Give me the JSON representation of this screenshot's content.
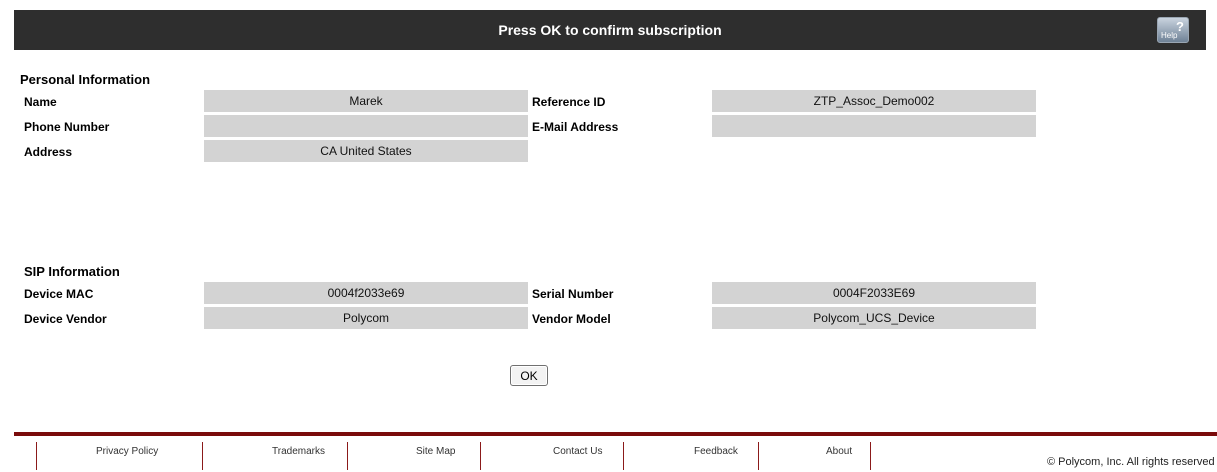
{
  "header": {
    "title": "Press OK to confirm subscription",
    "help_label": "Help",
    "help_icon": "help-icon"
  },
  "personal": {
    "title": "Personal Information",
    "name_label": "Name",
    "name_value": "Marek",
    "reference_label": "Reference ID",
    "reference_value": "ZTP_Assoc_Demo002",
    "phone_label": "Phone Number",
    "phone_value": "",
    "email_label": "E-Mail Address",
    "email_value": "",
    "address_label": "Address",
    "address_value": "CA United States"
  },
  "sip": {
    "title": "SIP Information",
    "mac_label": "Device MAC",
    "mac_value": "0004f2033e69",
    "serial_label": "Serial Number",
    "serial_value": "0004F2033E69",
    "vendor_label": "Device Vendor",
    "vendor_value": "Polycom",
    "model_label": "Vendor Model",
    "model_value": "Polycom_UCS_Device"
  },
  "ok_label": "OK",
  "footer": {
    "links": [
      "Privacy Policy",
      "Trademarks",
      "Site Map",
      "Contact Us",
      "Feedback",
      "About"
    ],
    "copyright": "© Polycom, Inc. All rights reserved"
  },
  "colors": {
    "header_bg": "#2e2e2e",
    "field_bg": "#d3d3d3",
    "footer_bar": "#7a0b0b"
  }
}
